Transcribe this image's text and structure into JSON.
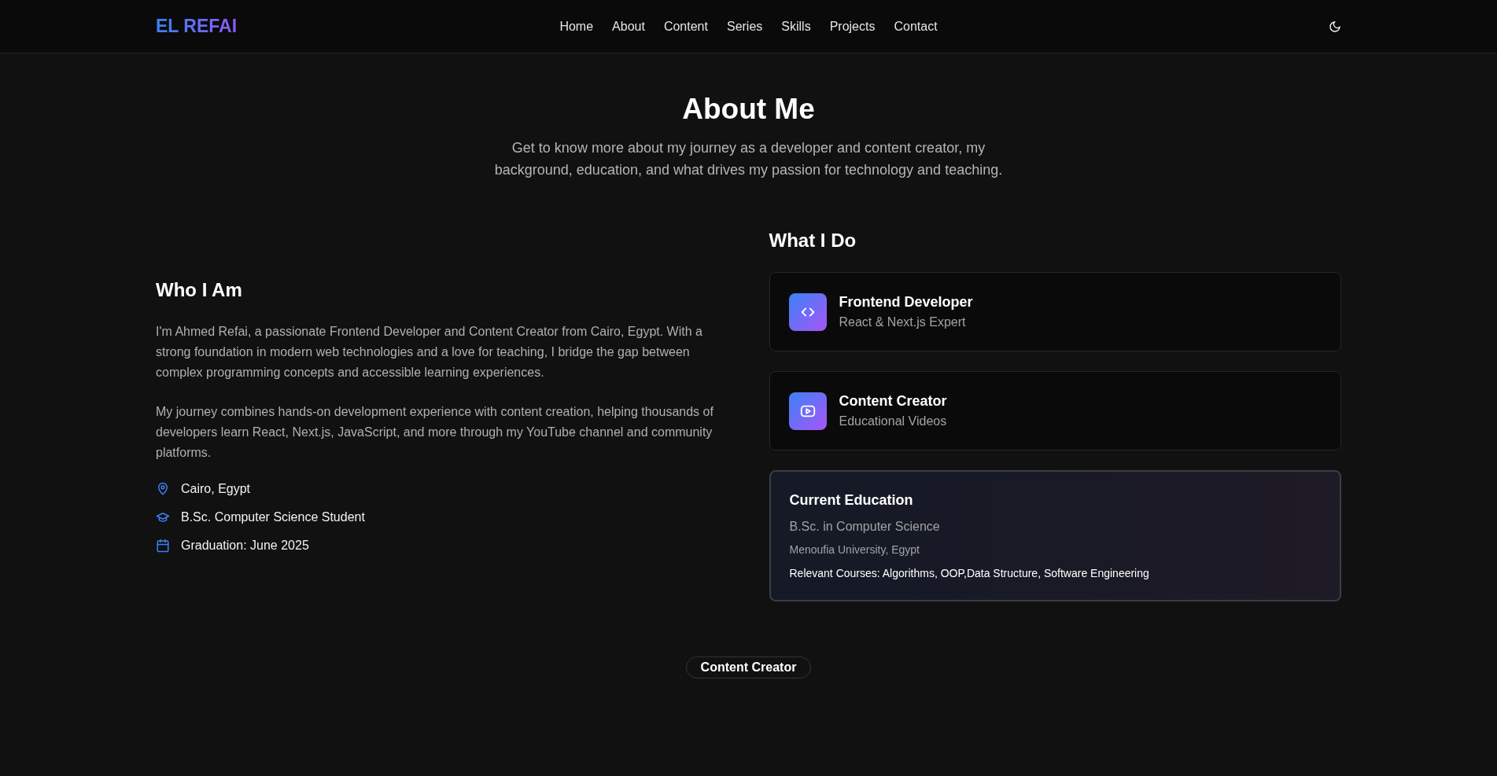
{
  "nav": {
    "logo": "EL REFAI",
    "links": [
      {
        "label": "Home",
        "selected": false
      },
      {
        "label": "About",
        "selected": false
      },
      {
        "label": "Content",
        "selected": false
      },
      {
        "label": "Series",
        "selected": false
      },
      {
        "label": "Skills",
        "selected": false
      },
      {
        "label": "Projects",
        "selected": false
      },
      {
        "label": "Contact",
        "selected": false
      }
    ]
  },
  "header": {
    "title": "About Me",
    "subtitle": "Get to know more about my journey as a developer and content creator, my background, education, and what drives my passion for technology and teaching."
  },
  "who": {
    "title": "Who I Am",
    "paragraphs": [
      "I'm Ahmed Refai, a passionate Frontend Developer and Content Creator from Cairo, Egypt. With a strong foundation in modern web technologies and a love for teaching, I bridge the gap between complex programming concepts and accessible learning experiences.",
      "My journey combines hands-on development experience with content creation, helping thousands of developers learn React, Next.js, JavaScript, and more through my YouTube channel and community platforms."
    ],
    "facts": [
      {
        "kind": "location",
        "text": "Cairo, Egypt"
      },
      {
        "kind": "degree",
        "text": "B.Sc. Computer Science Student"
      },
      {
        "kind": "date",
        "text": "Graduation: June 2025"
      }
    ]
  },
  "what": {
    "title": "What I Do",
    "cards": [
      {
        "kind": "code",
        "title": "Frontend Developer",
        "subtitle": "React & Next.js Expert"
      },
      {
        "kind": "video",
        "title": "Content Creator",
        "subtitle": "Educational Videos"
      }
    ],
    "education": {
      "title": "Current Education",
      "degree": "B.Sc. in Computer Science",
      "school": "Menoufia University, Egypt",
      "courses": "Relevant Courses: Algorithms, OOP,Data Structure, Software Engineering"
    }
  },
  "next_section": {
    "badge": "Content Creator"
  }
}
